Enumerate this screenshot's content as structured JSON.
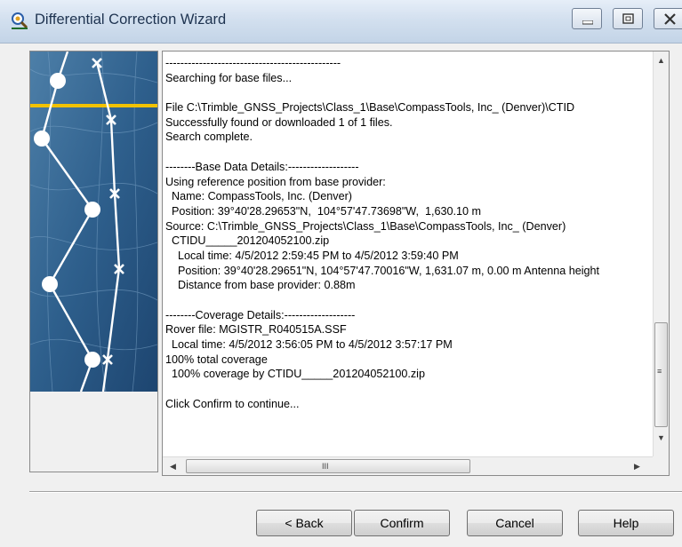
{
  "window": {
    "title": "Differential Correction Wizard",
    "min_icon": "minimize-icon",
    "max_icon": "maximize-icon",
    "close_icon": "close-icon",
    "app_icon": "wizard-app-icon"
  },
  "log": {
    "lines": [
      "-----------------------------------------------",
      "Searching for base files...",
      "",
      "File C:\\Trimble_GNSS_Projects\\Class_1\\Base\\CompassTools, Inc_ (Denver)\\CTID",
      "Successfully found or downloaded 1 of 1 files.",
      "Search complete.",
      "",
      "--------Base Data Details:-------------------",
      "Using reference position from base provider:",
      "  Name: CompassTools, Inc. (Denver)",
      "  Position: 39°40'28.29653\"N,  104°57'47.73698\"W,  1,630.10 m",
      "Source: C:\\Trimble_GNSS_Projects\\Class_1\\Base\\CompassTools, Inc_ (Denver)",
      "  CTIDU_____201204052100.zip",
      "    Local time: 4/5/2012 2:59:45 PM to 4/5/2012 3:59:40 PM",
      "    Position: 39°40'28.29651\"N, 104°57'47.70016\"W, 1,631.07 m, 0.00 m Antenna height",
      "    Distance from base provider: 0.88m",
      "",
      "--------Coverage Details:-------------------",
      "Rover file: MGISTR_R040515A.SSF",
      "  Local time: 4/5/2012 3:56:05 PM to 4/5/2012 3:57:17 PM",
      "100% total coverage",
      "  100% coverage by CTIDU_____201204052100.zip",
      "",
      "Click Confirm to continue..."
    ],
    "scroll_up_icon": "scroll-up-arrow-icon",
    "scroll_down_icon": "scroll-down-arrow-icon",
    "scroll_left_icon": "scroll-left-arrow-icon",
    "scroll_right_icon": "scroll-right-arrow-icon",
    "vgrip": "≡",
    "hgrip": "III"
  },
  "buttons": {
    "back": "< Back",
    "confirm": "Confirm",
    "cancel": "Cancel",
    "help": "Help"
  }
}
